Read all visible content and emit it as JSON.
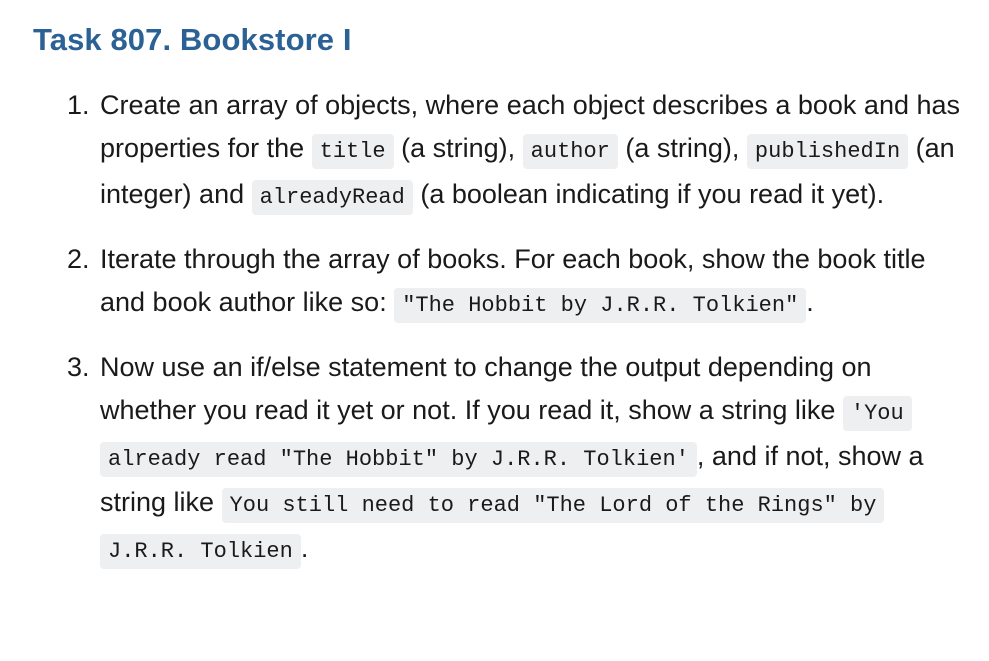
{
  "title": "Task 807. Bookstore I",
  "items": [
    {
      "number": "1.",
      "t1": "Create an array of objects, where each object describes a book and has properties for the ",
      "c1": "title",
      "t2": " (a string), ",
      "c2": "author",
      "t3": " (a string), ",
      "c3": "publishedIn",
      "t4": " (an integer) and ",
      "c4": "alreadyRead",
      "t5": " (a boolean indicating if you read it yet)."
    },
    {
      "number": "2.",
      "t1": "Iterate through the array of books. For each book, show the book title and book author like so: ",
      "c1": "\"The Hobbit by J.R.R. Tolkien\"",
      "t2": "."
    },
    {
      "number": "3.",
      "t1": "Now use an if/else statement to change the output depending on whether you read it yet or not. If you read it, show a string like ",
      "c1": "'You already read \"The Hobbit\" by J.R.R. Tolkien'",
      "t2": ", and if not, show a string like ",
      "c2": "You still need to read \"The Lord of the Rings\" by J.R.R. Tolkien",
      "t3": "."
    }
  ]
}
